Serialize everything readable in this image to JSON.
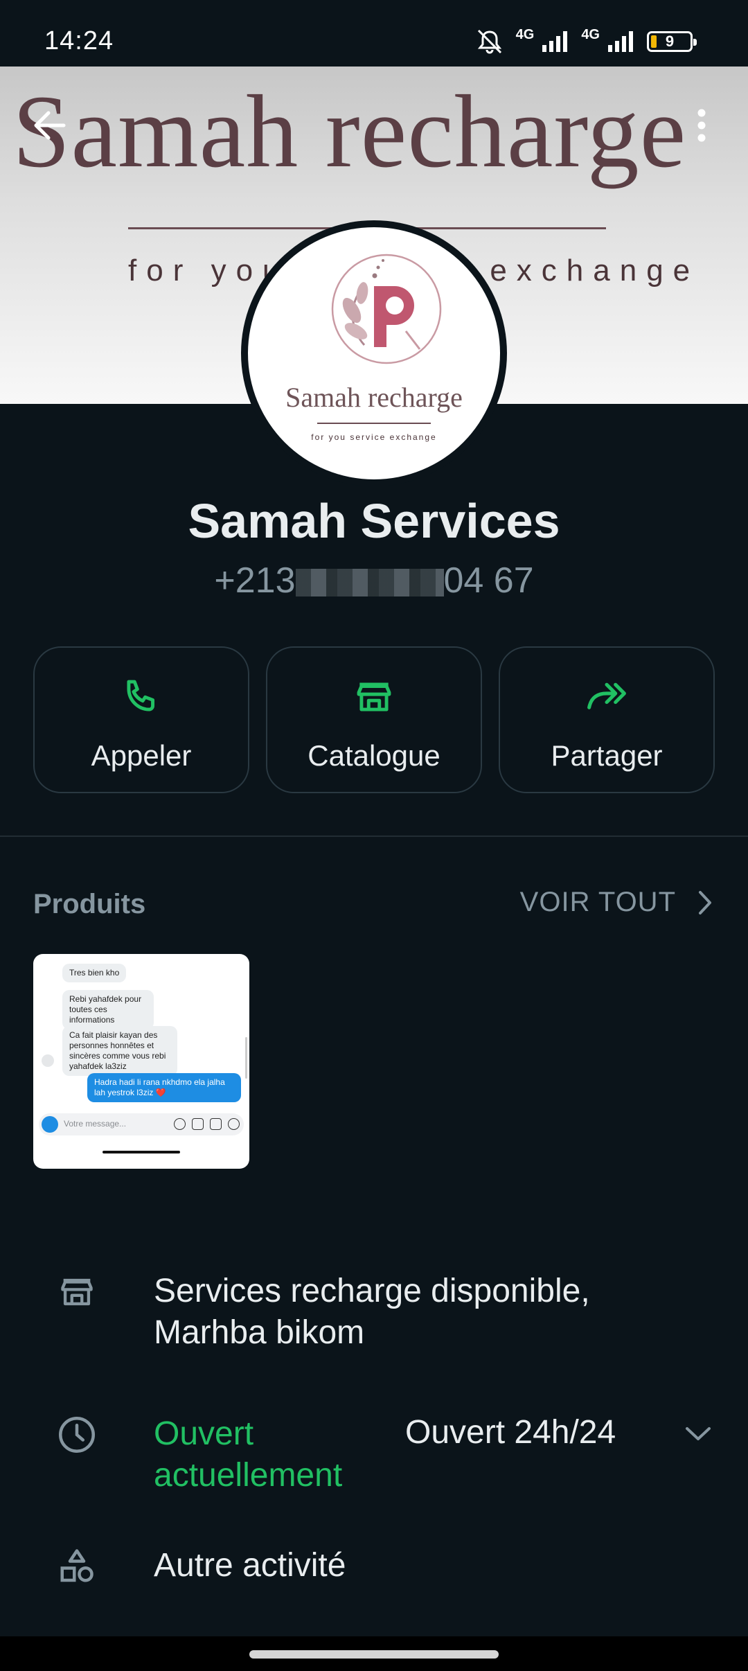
{
  "status_bar": {
    "time": "14:24",
    "network_1": "4G",
    "network_2": "4G",
    "battery": "9"
  },
  "cover": {
    "title": "Samah recharge",
    "subtitle": "for you service exchange"
  },
  "avatar": {
    "name": "Samah recharge",
    "tagline": "for you service exchange"
  },
  "profile": {
    "name": "Samah Services",
    "phone_prefix": "+213",
    "phone_suffix": "04 67"
  },
  "actions": [
    {
      "label": "Appeler",
      "icon": "phone-icon"
    },
    {
      "label": "Catalogue",
      "icon": "store-icon"
    },
    {
      "label": "Partager",
      "icon": "share-icon"
    }
  ],
  "products": {
    "title": "Produits",
    "see_all": "VOIR TOUT",
    "thumbnail": {
      "messages": [
        "Tres bien kho",
        "Rebi yahafdek pour toutes ces informations",
        "Ca fait plaisir kayan des personnes honnêtes et sincères comme vous rebi yahafdek la3ziz",
        "Hadra hadi li rana nkhdmo ela jalha lah yestrok l3ziz ❤️"
      ],
      "composer_placeholder": "Votre message..."
    }
  },
  "info": {
    "description": "Services recharge disponible, Marhba bikom",
    "open_status": "Ouvert actuellement",
    "hours": "Ouvert 24h/24",
    "category": "Autre activité"
  },
  "colors": {
    "accent_green": "#21c063",
    "background": "#0b141a",
    "muted_text": "#8696a0"
  }
}
